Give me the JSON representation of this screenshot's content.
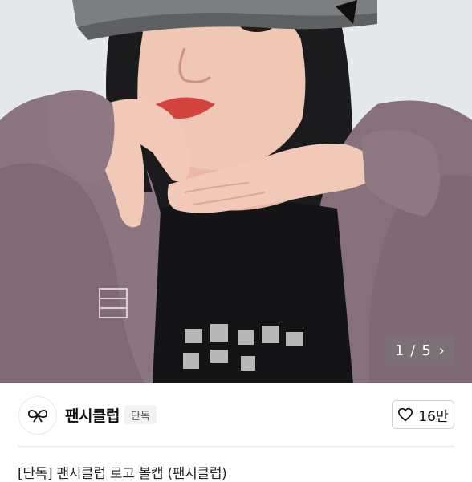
{
  "image_viewer": {
    "current_index": "1",
    "separator": "/",
    "total": "5",
    "next_glyph": "›"
  },
  "store": {
    "name": "팬시클럽",
    "badge": "단독",
    "logo_icon": "bow-logo-icon"
  },
  "like": {
    "icon": "heart-icon",
    "count": "16만"
  },
  "product": {
    "title": "[단독] 팬시클럽 로고 볼캡 (팬시클럽)"
  },
  "colors": {
    "jacket": "#8a7580",
    "cap": "#7c7e80",
    "background": "#e6e9ec",
    "lips": "#d4443e"
  }
}
